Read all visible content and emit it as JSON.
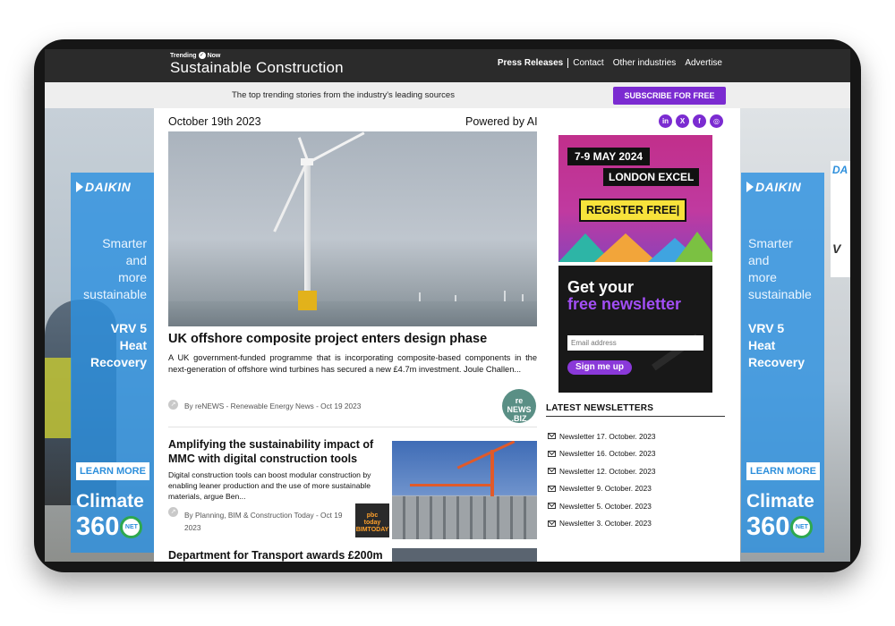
{
  "header": {
    "brand_small": "Trending",
    "brand_small_suffix": "Now",
    "brand_title": "Sustainable Construction",
    "nav": [
      "Press Releases",
      "Contact",
      "Other industries",
      "Advertise"
    ]
  },
  "subbar": {
    "tagline": "The top trending stories from the industry's leading sources",
    "subscribe_label": "SUBSCRIBE FOR FREE"
  },
  "side_ad": {
    "brand": "DAIKIN",
    "smart_lines": [
      "Smarter",
      "and",
      "more",
      "sustainable"
    ],
    "product_lines": [
      "VRV 5",
      "Heat",
      "Recovery"
    ],
    "cta": "LEARN MORE",
    "climate": "Climate",
    "number": "360",
    "badge": "NET"
  },
  "right_edge_ad": {
    "brand": "DA",
    "product": "V"
  },
  "main": {
    "date": "October 19th 2023",
    "powered": "Powered by AI",
    "articles": [
      {
        "title": "UK offshore composite project enters design phase",
        "excerpt": "A UK government-funded programme that is incorporating composite-based components in the next-generation of offshore wind turbines has secured a new £4.7m investment. Joule Challen...",
        "source": "By reNEWS - Renewable Energy News - Oct 19 2023",
        "logo": [
          "re",
          "NEWS",
          ".BIZ"
        ]
      },
      {
        "title": "Amplifying the sustainability impact of MMC with digital construction tools",
        "excerpt": "Digital construction tools can boost modular construction by enabling leaner production and the use of more sustainable materials, argue Ben...",
        "source": "By Planning, BIM & Construction Today - Oct 19 2023",
        "logo": [
          "pbc",
          "today",
          "BIMTODAY"
        ]
      },
      {
        "title": "Department for Transport awards £200m"
      }
    ]
  },
  "sidebar": {
    "social": [
      "in",
      "X",
      "f",
      "ig"
    ],
    "expo": {
      "date": "7-9 MAY 2024",
      "venue": "LONDON EXCEL",
      "cta": "REGISTER FREE|"
    },
    "newsletter_ad": {
      "line1": "Get your",
      "line2": "free newsletter",
      "email_placeholder": "Email address",
      "button": "Sign me up"
    },
    "latest_title": "LATEST NEWSLETTERS",
    "newsletters": [
      "Newsletter 17. October. 2023",
      "Newsletter 16. October. 2023",
      "Newsletter 12. October. 2023",
      "Newsletter 9. October. 2023",
      "Newsletter 5. October. 2023",
      "Newsletter 3. October. 2023"
    ]
  },
  "colors": {
    "accent": "#7b2bd1",
    "header": "#2b2b2b",
    "ad_blue": "#2d8fdc"
  }
}
